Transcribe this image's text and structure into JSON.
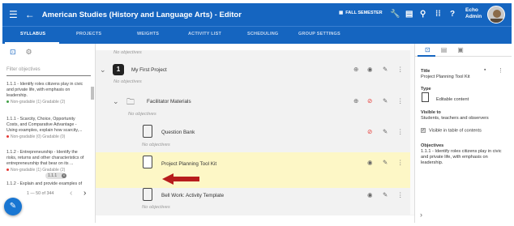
{
  "header": {
    "title": "American Studies (History and Language Arts) - Editor",
    "semester": "FALL SEMESTER",
    "user_line1": "Echo",
    "user_line2": "Admin"
  },
  "tabs": [
    "SYLLABUS",
    "PROJECTS",
    "WEIGHTS",
    "ACTIVITY LIST",
    "SCHEDULING",
    "GROUP SETTINGS"
  ],
  "left": {
    "filter_placeholder": "Filter objectives",
    "objectives": [
      {
        "text": "1.1.1 - Identify roles citizens play in civic and private life, with emphasis on leadership.",
        "status": "Non-gradable (1)",
        "gradable": "Gradable (2)"
      },
      {
        "text": "1.1.1 - Scarcity, Choice, Opportunity Costs, and Comparative Advantage - Using examples, explain how scarcity,...",
        "status": "Non-gradable (0)",
        "gradable": "Gradable (0)"
      },
      {
        "text": "1.1.2 - Entrepreneurship - Identify the risks, returns and other characteristics of entrepreneurship that bear on its ...",
        "status": "Non-gradable (1)",
        "gradable": "Gradable (2)"
      },
      {
        "text": "1.1.2 - Explain and provide examples of"
      }
    ],
    "pager": "1 — 50 of 344"
  },
  "center": {
    "no_obj": "No objectives",
    "project_num": "1",
    "project": "My First Project",
    "folder": "Facilitator Materials",
    "item1": "Question Bank",
    "item2": "Project Planning Tool Kit",
    "chip": "1.1.1",
    "item3": "Bell Work: Activity Template"
  },
  "right": {
    "title_label": "Title",
    "title": "Project Planning Tool Kit",
    "type_label": "Type",
    "type": "Editable content",
    "visible_label": "Visible to",
    "visible": "Students, teachers and observers",
    "toc": "Visible in table of contents",
    "obj_label": "Objectives",
    "obj": "1.1.1 - Identify roles citizens play in civic and private life, with emphasis on leadership."
  },
  "colors": {
    "brand": "#1565c0",
    "highlight": "#fdf7c6",
    "hidden": "#e53935",
    "arrow": "#b71c1c"
  }
}
